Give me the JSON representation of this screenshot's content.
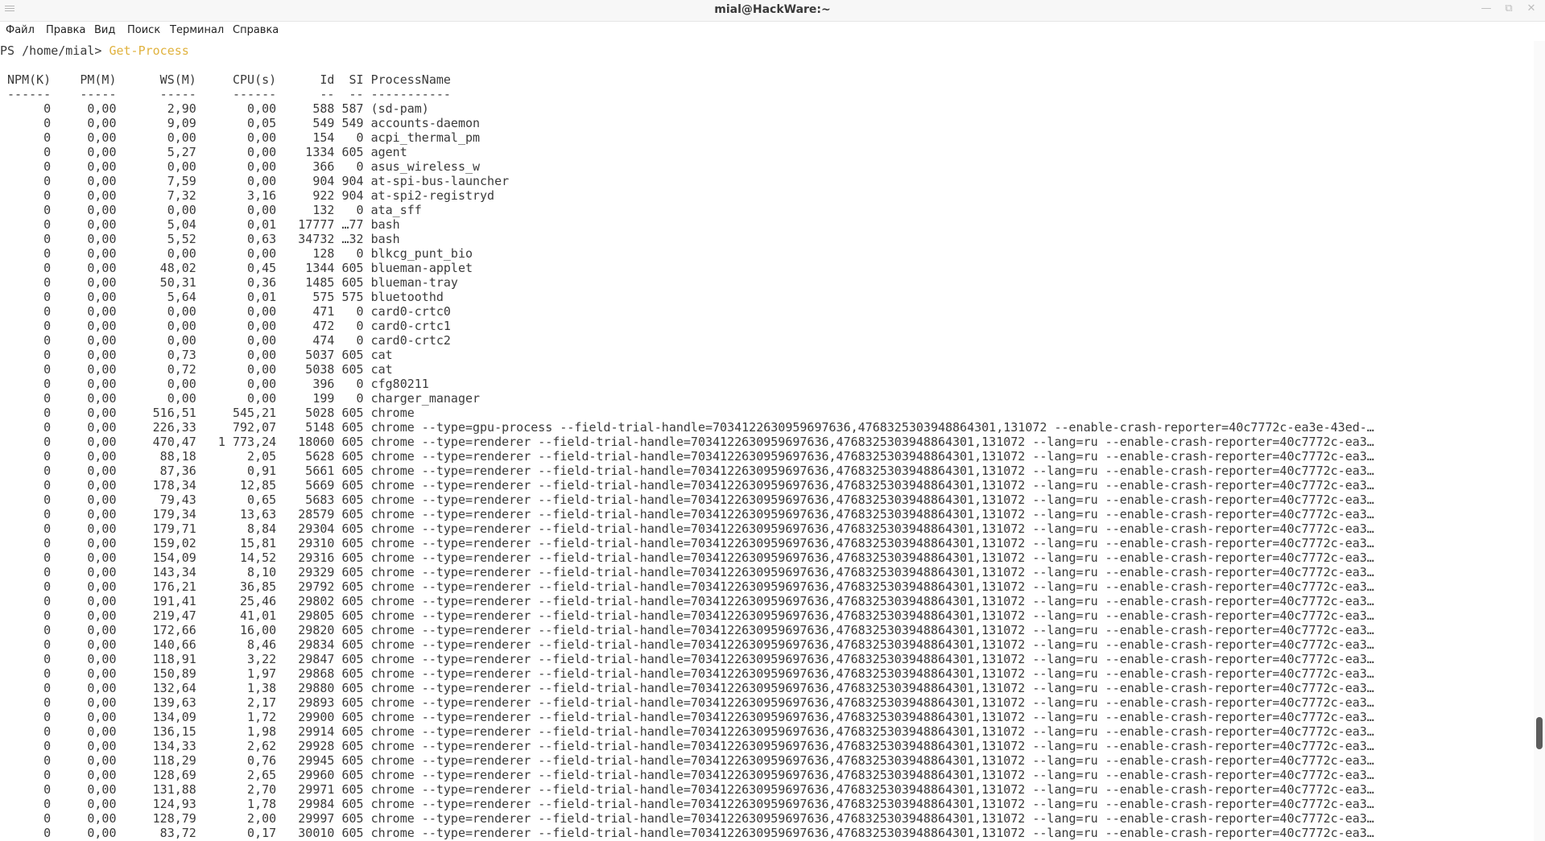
{
  "window": {
    "title": "mial@HackWare:~",
    "buttons": [
      "—",
      "⧉",
      "✕"
    ]
  },
  "menu": [
    "Файл",
    "Правка",
    "Вид",
    "Поиск",
    "Терминал",
    "Справка"
  ],
  "terminal": {
    "prompt": "PS /home/mial> ",
    "command": "Get-Process",
    "header": " NPM(K)    PM(M)      WS(M)     CPU(s)      Id  SI ProcessName",
    "separator": " ------    -----      -----     ------      --  -- -----------",
    "rows": [
      "      0     0,00       2,90       0,00     588 587 (sd-pam)",
      "      0     0,00       9,09       0,05     549 549 accounts-daemon",
      "      0     0,00       0,00       0,00     154   0 acpi_thermal_pm",
      "      0     0,00       5,27       0,00    1334 605 agent",
      "      0     0,00       0,00       0,00     366   0 asus_wireless_w",
      "      0     0,00       7,59       0,00     904 904 at-spi-bus-launcher",
      "      0     0,00       7,32       3,16     922 904 at-spi2-registryd",
      "      0     0,00       0,00       0,00     132   0 ata_sff",
      "      0     0,00       5,04       0,01   17777 …77 bash",
      "      0     0,00       5,52       0,63   34732 …32 bash",
      "      0     0,00       0,00       0,00     128   0 blkcg_punt_bio",
      "      0     0,00      48,02       0,45    1344 605 blueman-applet",
      "      0     0,00      50,31       0,36    1485 605 blueman-tray",
      "      0     0,00       5,64       0,01     575 575 bluetoothd",
      "      0     0,00       0,00       0,00     471   0 card0-crtc0",
      "      0     0,00       0,00       0,00     472   0 card0-crtc1",
      "      0     0,00       0,00       0,00     474   0 card0-crtc2",
      "      0     0,00       0,73       0,00    5037 605 cat",
      "      0     0,00       0,72       0,00    5038 605 cat",
      "      0     0,00       0,00       0,00     396   0 cfg80211",
      "      0     0,00       0,00       0,00     199   0 charger_manager",
      "      0     0,00     516,51     545,21    5028 605 chrome",
      "      0     0,00     226,33     792,07    5148 605 chrome --type=gpu-process --field-trial-handle=7034122630959697636,4768325303948864301,131072 --enable-crash-reporter=40c7772c-ea3e-43ed-…",
      "      0     0,00     470,47   1 773,24   18060 605 chrome --type=renderer --field-trial-handle=7034122630959697636,4768325303948864301,131072 --lang=ru --enable-crash-reporter=40c7772c-ea3…",
      "      0     0,00      88,18       2,05    5628 605 chrome --type=renderer --field-trial-handle=7034122630959697636,4768325303948864301,131072 --lang=ru --enable-crash-reporter=40c7772c-ea3…",
      "      0     0,00      87,36       0,91    5661 605 chrome --type=renderer --field-trial-handle=7034122630959697636,4768325303948864301,131072 --lang=ru --enable-crash-reporter=40c7772c-ea3…",
      "      0     0,00     178,34      12,85    5669 605 chrome --type=renderer --field-trial-handle=7034122630959697636,4768325303948864301,131072 --lang=ru --enable-crash-reporter=40c7772c-ea3…",
      "      0     0,00      79,43       0,65    5683 605 chrome --type=renderer --field-trial-handle=7034122630959697636,4768325303948864301,131072 --lang=ru --enable-crash-reporter=40c7772c-ea3…",
      "      0     0,00     179,34      13,63   28579 605 chrome --type=renderer --field-trial-handle=7034122630959697636,4768325303948864301,131072 --lang=ru --enable-crash-reporter=40c7772c-ea3…",
      "      0     0,00     179,71       8,84   29304 605 chrome --type=renderer --field-trial-handle=7034122630959697636,4768325303948864301,131072 --lang=ru --enable-crash-reporter=40c7772c-ea3…",
      "      0     0,00     159,02      15,81   29310 605 chrome --type=renderer --field-trial-handle=7034122630959697636,4768325303948864301,131072 --lang=ru --enable-crash-reporter=40c7772c-ea3…",
      "      0     0,00     154,09      14,52   29316 605 chrome --type=renderer --field-trial-handle=7034122630959697636,4768325303948864301,131072 --lang=ru --enable-crash-reporter=40c7772c-ea3…",
      "      0     0,00     143,34       8,10   29329 605 chrome --type=renderer --field-trial-handle=7034122630959697636,4768325303948864301,131072 --lang=ru --enable-crash-reporter=40c7772c-ea3…",
      "      0     0,00     176,21      36,85   29792 605 chrome --type=renderer --field-trial-handle=7034122630959697636,4768325303948864301,131072 --lang=ru --enable-crash-reporter=40c7772c-ea3…",
      "      0     0,00     191,41      25,46   29802 605 chrome --type=renderer --field-trial-handle=7034122630959697636,4768325303948864301,131072 --lang=ru --enable-crash-reporter=40c7772c-ea3…",
      "      0     0,00     219,47      41,01   29805 605 chrome --type=renderer --field-trial-handle=7034122630959697636,4768325303948864301,131072 --lang=ru --enable-crash-reporter=40c7772c-ea3…",
      "      0     0,00     172,66      16,00   29820 605 chrome --type=renderer --field-trial-handle=7034122630959697636,4768325303948864301,131072 --lang=ru --enable-crash-reporter=40c7772c-ea3…",
      "      0     0,00     140,66       8,46   29834 605 chrome --type=renderer --field-trial-handle=7034122630959697636,4768325303948864301,131072 --lang=ru --enable-crash-reporter=40c7772c-ea3…",
      "      0     0,00     118,91       3,22   29847 605 chrome --type=renderer --field-trial-handle=7034122630959697636,4768325303948864301,131072 --lang=ru --enable-crash-reporter=40c7772c-ea3…",
      "      0     0,00     150,89       1,97   29868 605 chrome --type=renderer --field-trial-handle=7034122630959697636,4768325303948864301,131072 --lang=ru --enable-crash-reporter=40c7772c-ea3…",
      "      0     0,00     132,64       1,38   29880 605 chrome --type=renderer --field-trial-handle=7034122630959697636,4768325303948864301,131072 --lang=ru --enable-crash-reporter=40c7772c-ea3…",
      "      0     0,00     139,63       2,17   29893 605 chrome --type=renderer --field-trial-handle=7034122630959697636,4768325303948864301,131072 --lang=ru --enable-crash-reporter=40c7772c-ea3…",
      "      0     0,00     134,09       1,72   29900 605 chrome --type=renderer --field-trial-handle=7034122630959697636,4768325303948864301,131072 --lang=ru --enable-crash-reporter=40c7772c-ea3…",
      "      0     0,00     136,15       1,98   29914 605 chrome --type=renderer --field-trial-handle=7034122630959697636,4768325303948864301,131072 --lang=ru --enable-crash-reporter=40c7772c-ea3…",
      "      0     0,00     134,33       2,62   29928 605 chrome --type=renderer --field-trial-handle=7034122630959697636,4768325303948864301,131072 --lang=ru --enable-crash-reporter=40c7772c-ea3…",
      "      0     0,00     118,29       0,76   29945 605 chrome --type=renderer --field-trial-handle=7034122630959697636,4768325303948864301,131072 --lang=ru --enable-crash-reporter=40c7772c-ea3…",
      "      0     0,00     128,69       2,65   29960 605 chrome --type=renderer --field-trial-handle=7034122630959697636,4768325303948864301,131072 --lang=ru --enable-crash-reporter=40c7772c-ea3…",
      "      0     0,00     131,88       2,70   29971 605 chrome --type=renderer --field-trial-handle=7034122630959697636,4768325303948864301,131072 --lang=ru --enable-crash-reporter=40c7772c-ea3…",
      "      0     0,00     124,93       1,78   29984 605 chrome --type=renderer --field-trial-handle=7034122630959697636,4768325303948864301,131072 --lang=ru --enable-crash-reporter=40c7772c-ea3…",
      "      0     0,00     128,79       2,00   29997 605 chrome --type=renderer --field-trial-handle=7034122630959697636,4768325303948864301,131072 --lang=ru --enable-crash-reporter=40c7772c-ea3…",
      "      0     0,00      83,72       0,17   30010 605 chrome --type=renderer --field-trial-handle=7034122630959697636,4768325303948864301,131072 --lang=ru --enable-crash-reporter=40c7772c-ea3…"
    ]
  }
}
